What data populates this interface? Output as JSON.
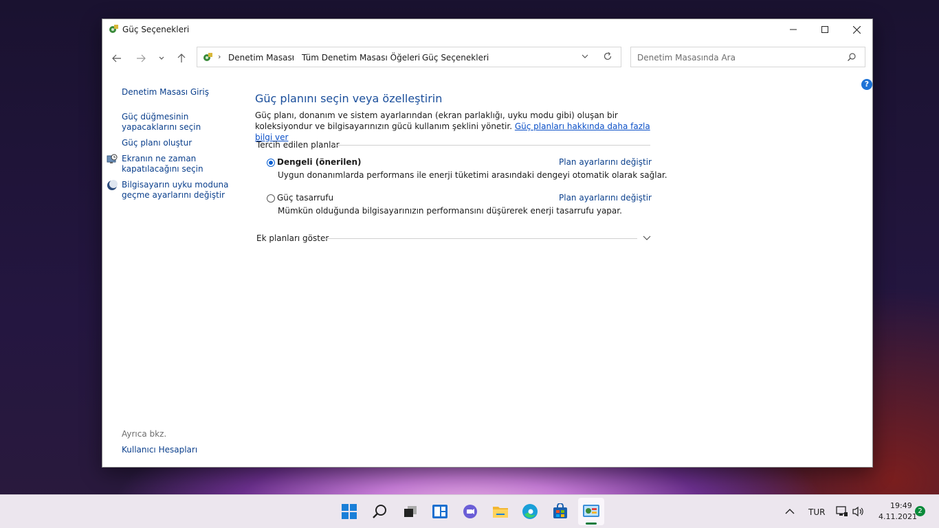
{
  "window": {
    "title": "Güç Seçenekleri"
  },
  "address": {
    "crumbs": [
      "Denetim Masası",
      "Tüm Denetim Masası Öğeleri",
      "Güç Seçenekleri"
    ]
  },
  "search": {
    "placeholder": "Denetim Masasında Ara"
  },
  "left_pane": {
    "home": "Denetim Masası Giriş",
    "items": [
      {
        "label": "Güç düğmesinin yapacaklarını seçin",
        "icon": "none"
      },
      {
        "label": "Güç planı oluştur",
        "icon": "none"
      },
      {
        "label": "Ekranın ne zaman kapatılacağını seçin",
        "icon": "monitor-clock-icon"
      },
      {
        "label": "Bilgisayarın uyku moduna geçme ayarlarını değiştir",
        "icon": "moon-icon"
      }
    ],
    "see_also_label": "Ayrıca bkz.",
    "see_also_link": "Kullanıcı Hesapları"
  },
  "main": {
    "title": "Güç planını seçin veya özelleştirin",
    "description": "Güç planı, donanım ve sistem ayarlarından (ekran parlaklığı, uyku modu gibi) oluşan bir koleksiyondur ve bilgisayarınızın gücü kullanım şeklini yönetir.",
    "more_link": "Güç planları hakkında daha fazla bilgi ver",
    "preferred_label": "Tercih edilen planlar",
    "plans": [
      {
        "name": "Dengeli (önerilen)",
        "description": "Uygun donanımlarda performans ile enerji tüketimi arasındaki dengeyi otomatik olarak sağlar.",
        "link": "Plan ayarlarını değiştir",
        "selected": true
      },
      {
        "name": "Güç tasarrufu",
        "description": "Mümkün olduğunda bilgisayarınızın performansını düşürerek enerji tasarrufu yapar.",
        "link": "Plan ayarlarını değiştir",
        "selected": false
      }
    ],
    "additional_label": "Ek planları göster"
  },
  "taskbar": {
    "apps": [
      "windows-start-icon",
      "search-icon",
      "task-view-icon",
      "widgets-icon",
      "teams-chat-icon",
      "file-explorer-icon",
      "edge-icon",
      "store-icon",
      "control-panel-icon"
    ],
    "language": "TUR",
    "time": "19:49",
    "date": "4.11.2021",
    "notifications": "2"
  },
  "colors": {
    "accent": "#0a5fd1",
    "link": "#0a3f8c",
    "title_blue": "#1a4e9b"
  }
}
